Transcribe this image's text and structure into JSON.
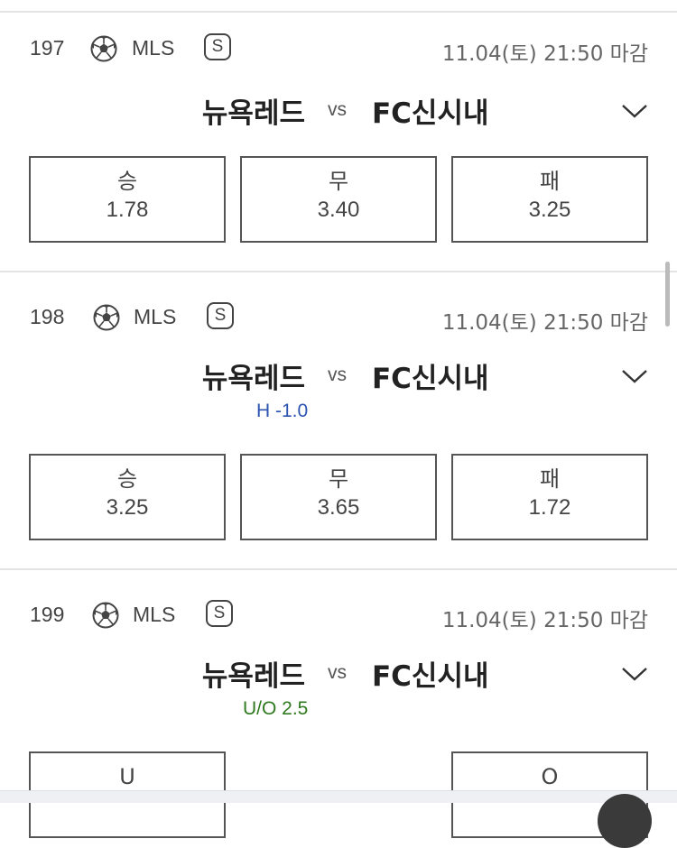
{
  "matches": [
    {
      "number": "197",
      "league": "MLS",
      "badge": "S",
      "deadline": "11.04(토) 21:50 마감",
      "home": "뉴욕레드",
      "vs": "vs",
      "away": "FC신시내",
      "handicap": "",
      "odds": [
        {
          "label": "승",
          "value": "1.78"
        },
        {
          "label": "무",
          "value": "3.40"
        },
        {
          "label": "패",
          "value": "3.25"
        }
      ]
    },
    {
      "number": "198",
      "league": "MLS",
      "badge": "S",
      "deadline": "11.04(토) 21:50 마감",
      "home": "뉴욕레드",
      "vs": "vs",
      "away": "FC신시내",
      "handicap": "H -1.0",
      "handicap_color": "#2c54b0",
      "odds": [
        {
          "label": "승",
          "value": "3.25"
        },
        {
          "label": "무",
          "value": "3.65"
        },
        {
          "label": "패",
          "value": "1.72"
        }
      ]
    },
    {
      "number": "199",
      "league": "MLS",
      "badge": "S",
      "deadline": "11.04(토) 21:50 마감",
      "home": "뉴욕레드",
      "vs": "vs",
      "away": "FC신시내",
      "handicap": "U/O 2.5",
      "handicap_color": "#2f7a1f",
      "odds": [
        {
          "label": "U",
          "value": ""
        },
        {
          "label": "O",
          "value": ""
        }
      ]
    }
  ]
}
